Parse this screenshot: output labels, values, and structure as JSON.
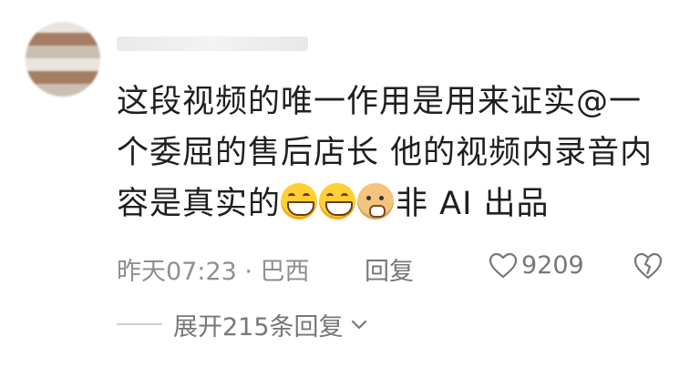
{
  "comment": {
    "username": "",
    "line1": "这段视频的唯一作用是用来证实@一",
    "line2": "个委屈的售后店长 他的视频内录音内",
    "line3_pre": "容是真实的",
    "line3_post": "非 AI 出品",
    "emojis": [
      "grin-emoji",
      "grin-emoji",
      "doge-emoji"
    ]
  },
  "meta": {
    "time_location": "昨天07:23 · 巴西",
    "reply_label": "回复",
    "like_count": "9209"
  },
  "expand": {
    "label": "展开215条回复"
  },
  "icons": {
    "like": "heart-icon",
    "dislike": "broken-heart-icon",
    "expand": "chevron-down-icon"
  }
}
